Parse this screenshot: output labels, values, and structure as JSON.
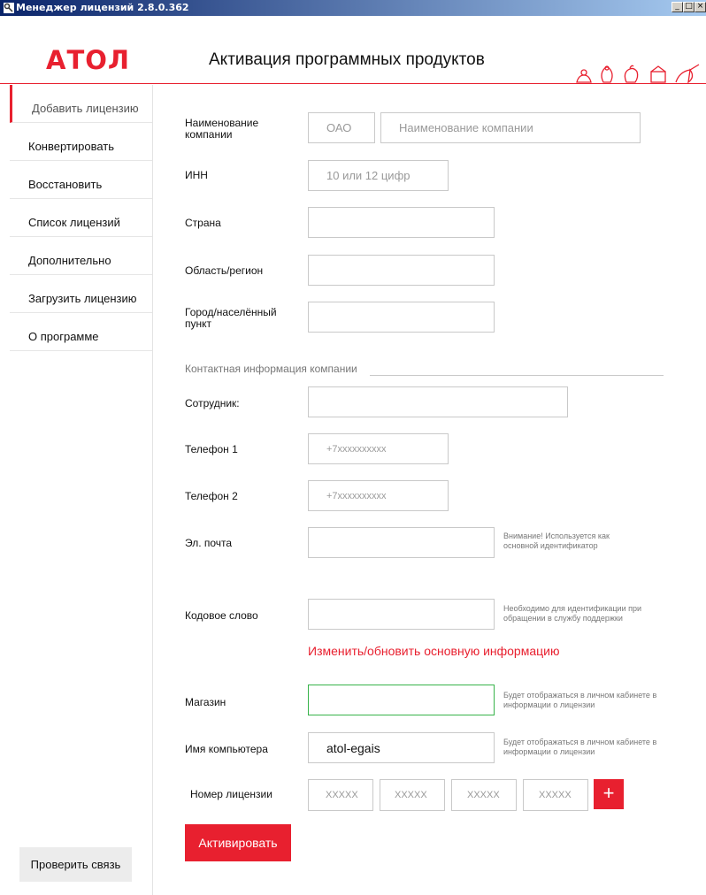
{
  "window": {
    "title": "Менеджер лицензий 2.8.0.362",
    "buttons": [
      "_",
      "□",
      "×"
    ]
  },
  "header": {
    "logo": "АТОЛ",
    "title": "Активация программных продуктов",
    "accent_color": "#e8202f"
  },
  "sidebar": {
    "items": [
      {
        "label": "Добавить лицензию",
        "active": true
      },
      {
        "label": "Конвертировать"
      },
      {
        "label": "Восстановить"
      },
      {
        "label": "Список лицензий"
      },
      {
        "label": "Дополнительно"
      },
      {
        "label": "Загрузить лицензию"
      },
      {
        "label": "О программе"
      }
    ],
    "check_button": "Проверить связь"
  },
  "form": {
    "company": {
      "label": "Наименование компании",
      "form_value": "ОАО",
      "name_placeholder": "Наименование компании"
    },
    "inn": {
      "label": "ИНН",
      "placeholder": "10 или 12 цифр"
    },
    "country": {
      "label": "Страна",
      "value": ""
    },
    "region": {
      "label": "Область/регион",
      "value": ""
    },
    "city": {
      "label": "Город/населённый пункт",
      "value": ""
    },
    "contact_section": "Контактная информация компании",
    "employee": {
      "label": "Сотрудник:",
      "value": ""
    },
    "phone1": {
      "label": "Телефон 1",
      "placeholder": "+7xxxxxxxxxx"
    },
    "phone2": {
      "label": "Телефон 2",
      "placeholder": "+7xxxxxxxxxx"
    },
    "email": {
      "label": "Эл. почта",
      "hint": "Внимание! Используется как основной идентификатор"
    },
    "codeword": {
      "label": "Кодовое слово",
      "hint": "Необходимо для идентификации при обращении в службу поддержки"
    },
    "update_link": "Изменить/обновить основную информацию",
    "shop": {
      "label": "Магазин",
      "value": "",
      "hint": "Будет отображаться в личном кабинете в информации о лицензии"
    },
    "computer": {
      "label": "Имя компьютера",
      "value": "atol-egais",
      "hint": "Будет отображаться в личном кабинете в информации о лицензии"
    },
    "license": {
      "label": "Номер лицензии",
      "parts": [
        "XXXXX",
        "XXXXX",
        "XXXXX",
        "XXXXX"
      ],
      "add": "+"
    },
    "activate": "Активировать"
  }
}
